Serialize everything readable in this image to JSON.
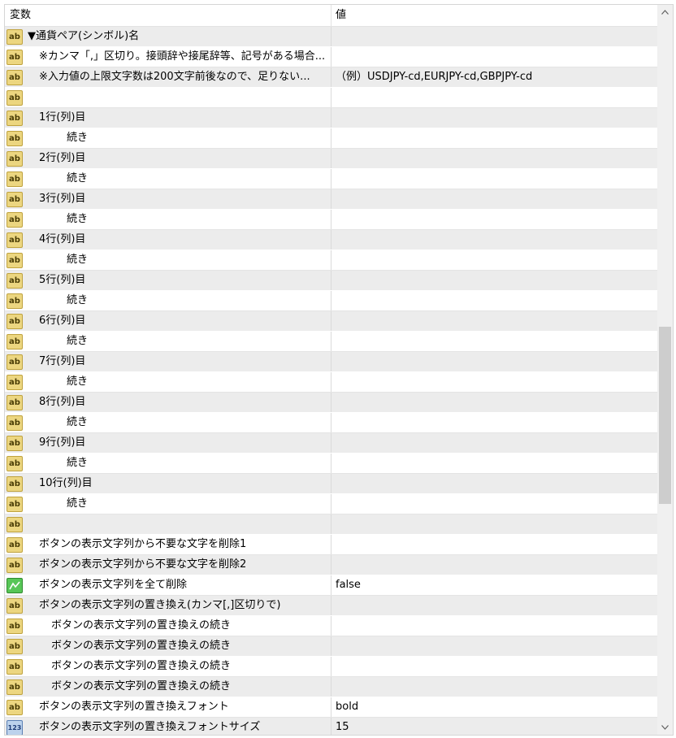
{
  "header": {
    "name_col": "変数",
    "value_col": "値"
  },
  "rows": [
    {
      "icon": "ab",
      "level": 0,
      "name": "▼通貨ペア(シンボル)名",
      "value": "",
      "shade": true
    },
    {
      "icon": "ab",
      "level": 1,
      "name": "※カンマ「,」区切り。接頭辞や接尾辞等、記号がある場合...",
      "value": "",
      "shade": false
    },
    {
      "icon": "ab",
      "level": 1,
      "name": "※入力値の上限文字数は200文字前後なので、足りない...",
      "value": "（例）USDJPY-cd,EURJPY-cd,GBPJPY-cd",
      "shade": true
    },
    {
      "icon": "ab",
      "level": 0,
      "name": "",
      "value": "",
      "shade": false
    },
    {
      "icon": "ab",
      "level": 1,
      "name": "1行(列)目",
      "value": "",
      "shade": true
    },
    {
      "icon": "ab",
      "level": 3,
      "name": "続き",
      "value": "",
      "shade": false
    },
    {
      "icon": "ab",
      "level": 1,
      "name": "2行(列)目",
      "value": "",
      "shade": true
    },
    {
      "icon": "ab",
      "level": 3,
      "name": "続き",
      "value": "",
      "shade": false
    },
    {
      "icon": "ab",
      "level": 1,
      "name": "3行(列)目",
      "value": "",
      "shade": true
    },
    {
      "icon": "ab",
      "level": 3,
      "name": "続き",
      "value": "",
      "shade": false
    },
    {
      "icon": "ab",
      "level": 1,
      "name": "4行(列)目",
      "value": "",
      "shade": true
    },
    {
      "icon": "ab",
      "level": 3,
      "name": "続き",
      "value": "",
      "shade": false
    },
    {
      "icon": "ab",
      "level": 1,
      "name": "5行(列)目",
      "value": "",
      "shade": true
    },
    {
      "icon": "ab",
      "level": 3,
      "name": "続き",
      "value": "",
      "shade": false
    },
    {
      "icon": "ab",
      "level": 1,
      "name": "6行(列)目",
      "value": "",
      "shade": true
    },
    {
      "icon": "ab",
      "level": 3,
      "name": "続き",
      "value": "",
      "shade": false
    },
    {
      "icon": "ab",
      "level": 1,
      "name": "7行(列)目",
      "value": "",
      "shade": true
    },
    {
      "icon": "ab",
      "level": 3,
      "name": "続き",
      "value": "",
      "shade": false
    },
    {
      "icon": "ab",
      "level": 1,
      "name": "8行(列)目",
      "value": "",
      "shade": true
    },
    {
      "icon": "ab",
      "level": 3,
      "name": "続き",
      "value": "",
      "shade": false
    },
    {
      "icon": "ab",
      "level": 1,
      "name": "9行(列)目",
      "value": "",
      "shade": true
    },
    {
      "icon": "ab",
      "level": 3,
      "name": "続き",
      "value": "",
      "shade": false
    },
    {
      "icon": "ab",
      "level": 1,
      "name": "10行(列)目",
      "value": "",
      "shade": true
    },
    {
      "icon": "ab",
      "level": 3,
      "name": "続き",
      "value": "",
      "shade": false
    },
    {
      "icon": "ab",
      "level": 0,
      "name": "",
      "value": "",
      "shade": true
    },
    {
      "icon": "ab",
      "level": 1,
      "name": "ボタンの表示文字列から不要な文字を削除1",
      "value": "",
      "shade": false
    },
    {
      "icon": "ab",
      "level": 1,
      "name": "ボタンの表示文字列から不要な文字を削除2",
      "value": "",
      "shade": true
    },
    {
      "icon": "bool",
      "level": 1,
      "name": "ボタンの表示文字列を全て削除",
      "value": "false",
      "shade": false
    },
    {
      "icon": "ab",
      "level": 1,
      "name": "ボタンの表示文字列の置き換え(カンマ[,]区切りで)",
      "value": "",
      "shade": true
    },
    {
      "icon": "ab",
      "level": 2,
      "name": "ボタンの表示文字列の置き換えの続き",
      "value": "",
      "shade": false
    },
    {
      "icon": "ab",
      "level": 2,
      "name": "ボタンの表示文字列の置き換えの続き",
      "value": "",
      "shade": true
    },
    {
      "icon": "ab",
      "level": 2,
      "name": "ボタンの表示文字列の置き換えの続き",
      "value": "",
      "shade": false
    },
    {
      "icon": "ab",
      "level": 2,
      "name": "ボタンの表示文字列の置き換えの続き",
      "value": "",
      "shade": true
    },
    {
      "icon": "ab",
      "level": 1,
      "name": "ボタンの表示文字列の置き換えフォント",
      "value": "bold",
      "shade": false
    },
    {
      "icon": "num",
      "level": 1,
      "name": "ボタンの表示文字列の置き換えフォントサイズ",
      "value": "15",
      "shade": true
    }
  ],
  "icons": {
    "ab": "ab-string-icon",
    "bool": "bool-icon",
    "num": "number-icon"
  },
  "icon_glyphs": {
    "ab": "ab",
    "num": "123"
  },
  "scrollbar": {
    "position": "middle"
  },
  "colors": {
    "shade_row": "#ececec",
    "plain_row": "#ffffff",
    "thumb": "#cdcdcd"
  }
}
